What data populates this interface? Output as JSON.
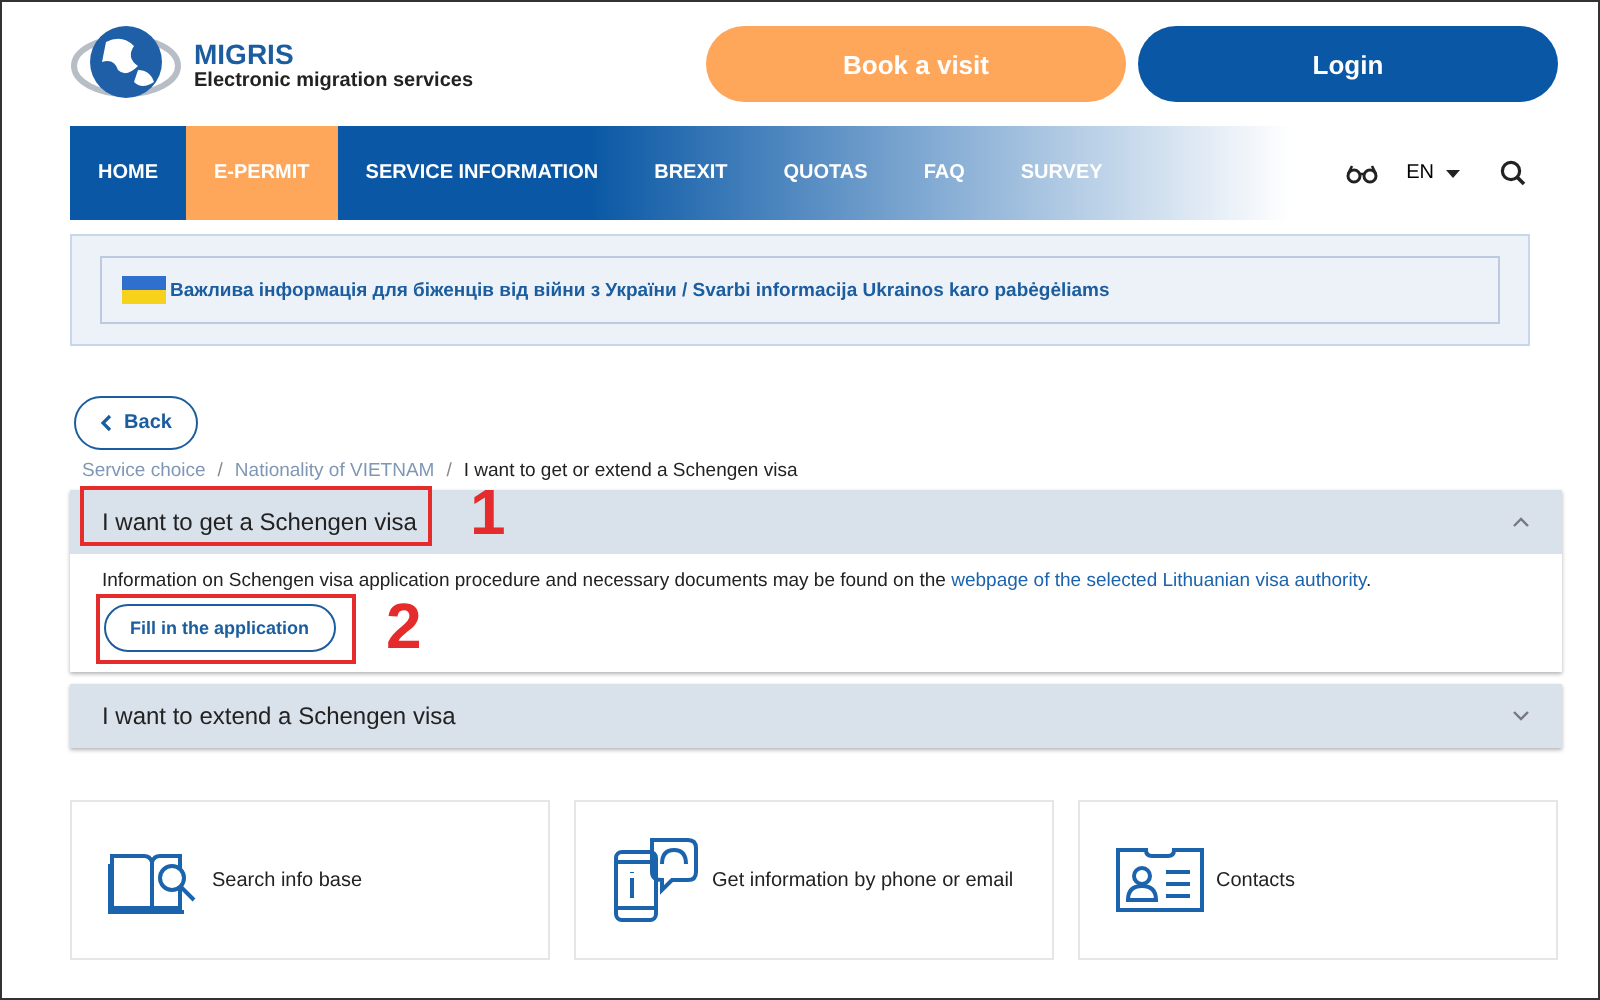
{
  "logo": {
    "title": "MIGRIS",
    "subtitle": "Electronic migration services"
  },
  "header_buttons": [
    {
      "label": "Book a visit",
      "kind": "secondary"
    },
    {
      "label": "Login",
      "kind": "primary"
    }
  ],
  "nav": {
    "items": [
      {
        "label": "HOME",
        "selected": false
      },
      {
        "label": "E-PERMIT",
        "selected": true
      },
      {
        "label": "SERVICE INFORMATION",
        "selected": false
      },
      {
        "label": "BREXIT",
        "selected": false
      },
      {
        "label": "QUOTAS",
        "selected": false
      },
      {
        "label": "FAQ",
        "selected": false
      },
      {
        "label": "SURVEY",
        "selected": false
      }
    ],
    "language": "EN"
  },
  "notice": {
    "text": "Важлива інформація для біженців від війни з України / Svarbi informacija Ukrainos karo pabėgėliams"
  },
  "back_button": "Back",
  "breadcrumb_separator": "/",
  "breadcrumb": [
    {
      "label": "Service choice",
      "link": true
    },
    {
      "label": "Nationality of VIETNAM",
      "link": true
    },
    {
      "label": "I want to get or extend a Schengen visa",
      "link": false
    }
  ],
  "accordions": [
    {
      "title": "I want to get a Schengen visa",
      "expanded": true,
      "callout": "1",
      "text": "Information on Schengen visa application procedure and necessary documents may be found on the",
      "link": "webpage of the selected Lithuanian visa authority",
      "after_link": ".",
      "button": "Fill in the application",
      "button_callout": "2"
    },
    {
      "title": "I want to extend a Schengen visa",
      "expanded": false
    }
  ],
  "cards": [
    {
      "label": "Search info base",
      "kind": "search"
    },
    {
      "label": "Get information by phone or email",
      "kind": "phone"
    },
    {
      "label": "Contacts",
      "kind": "contacts"
    }
  ]
}
